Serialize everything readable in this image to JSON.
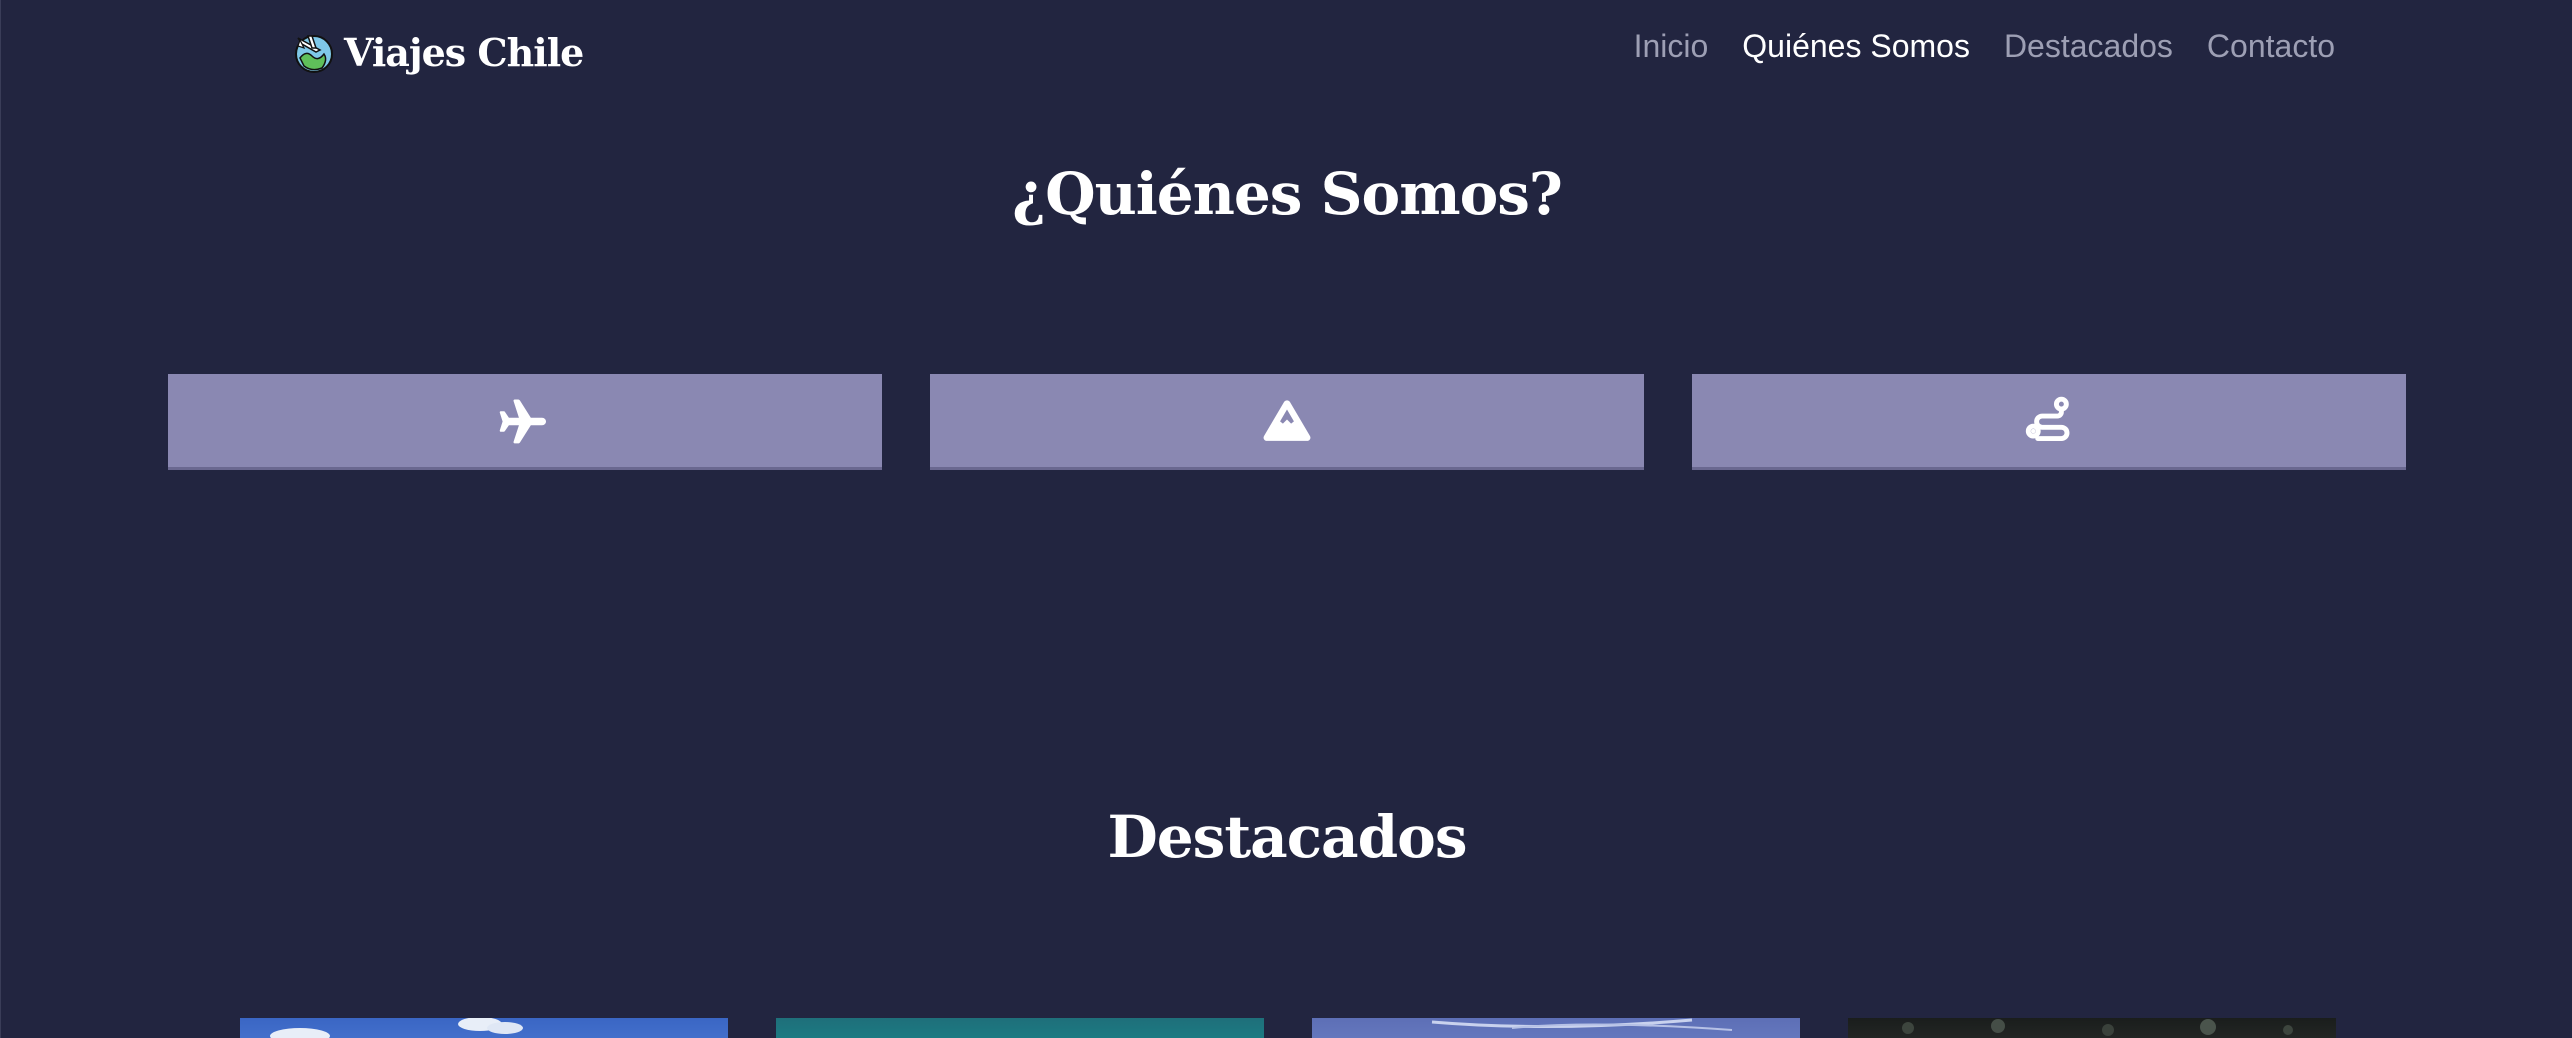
{
  "brand": {
    "name": "Viajes Chile",
    "logo_icon": "globe-airplane-icon"
  },
  "nav": {
    "items": [
      {
        "label": "Inicio",
        "active": false
      },
      {
        "label": "Quiénes Somos",
        "active": true
      },
      {
        "label": "Destacados",
        "active": false
      },
      {
        "label": "Contacto",
        "active": false
      }
    ]
  },
  "about": {
    "title": "¿Quiénes Somos?",
    "cards": [
      {
        "icon": "airplane-icon"
      },
      {
        "icon": "mountain-icon"
      },
      {
        "icon": "route-icon"
      }
    ]
  },
  "featured": {
    "title": "Destacados",
    "thumbnails": [
      {
        "icon": "sky-photo"
      },
      {
        "icon": "teal-photo"
      },
      {
        "icon": "sky-photo"
      },
      {
        "icon": "forest-photo"
      }
    ]
  },
  "colors": {
    "background": "#222540",
    "card": "#8a88b2",
    "nav_inactive": "#9d9fb4",
    "nav_active": "#ffffff"
  }
}
